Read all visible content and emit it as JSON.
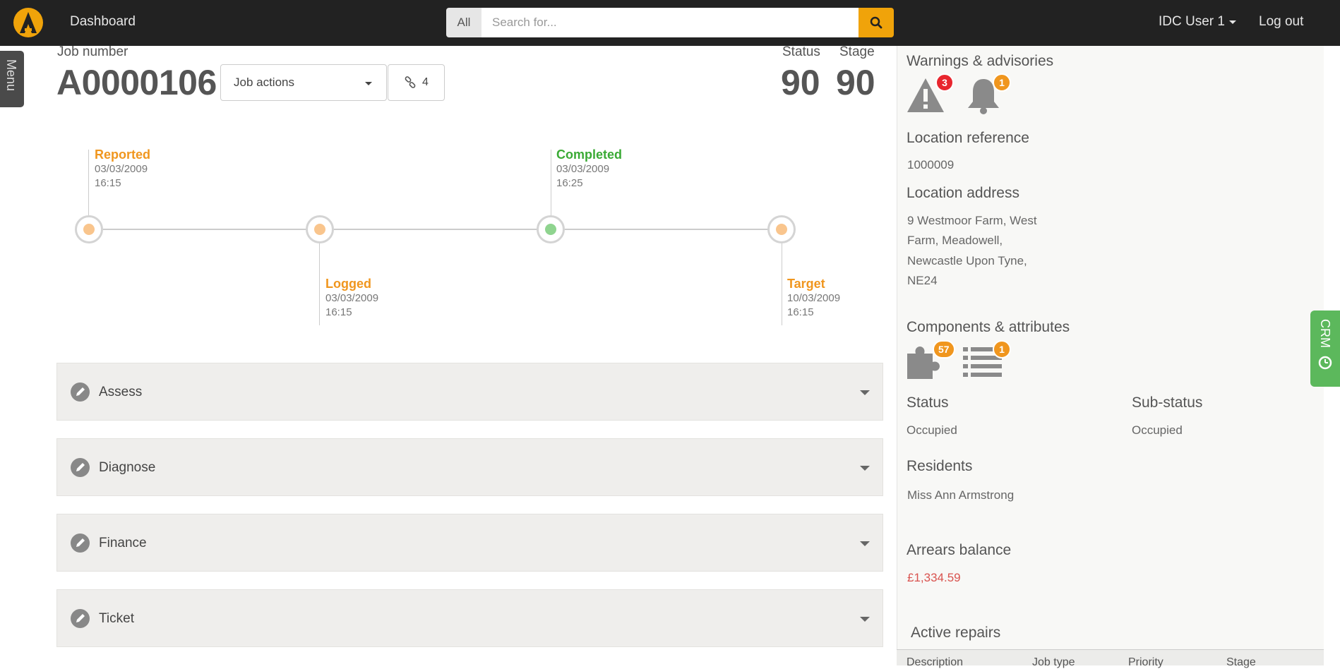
{
  "navbar": {
    "dashboard_label": "Dashboard",
    "search_scope": "All",
    "search_placeholder": "Search for...",
    "user_label": "IDC User 1",
    "logout_label": "Log out"
  },
  "side_menu": {
    "label": "Menu"
  },
  "job": {
    "number_label": "Job number",
    "number": "A0000106",
    "actions_label": "Job actions",
    "links_count": "4",
    "status_label": "Status",
    "status_value": "90",
    "stage_label": "Stage",
    "stage_value": "90"
  },
  "timeline": [
    {
      "title": "Reported",
      "date": "03/03/2009",
      "time": "16:15",
      "state": "pending",
      "color": "#f0961e"
    },
    {
      "title": "Logged",
      "date": "03/03/2009",
      "time": "16:15",
      "state": "pending",
      "color": "#f0961e"
    },
    {
      "title": "Completed",
      "date": "03/03/2009",
      "time": "16:25",
      "state": "done",
      "color": "#3aaa35"
    },
    {
      "title": "Target",
      "date": "10/03/2009",
      "time": "16:15",
      "state": "pending",
      "color": "#f0961e"
    }
  ],
  "sections": [
    {
      "label": "Assess"
    },
    {
      "label": "Diagnose"
    },
    {
      "label": "Finance"
    },
    {
      "label": "Ticket"
    }
  ],
  "panel": {
    "warnings_heading": "Warnings & advisories",
    "warnings_count": "3",
    "advisories_count": "1",
    "location_ref_heading": "Location reference",
    "location_ref_value": "1000009",
    "location_addr_heading": "Location address",
    "location_addr_lines": [
      "9 Westmoor Farm, West",
      "Farm, Meadowell,",
      "Newcastle Upon Tyne,",
      "NE24"
    ],
    "components_heading": "Components & attributes",
    "components_count": "57",
    "attributes_count": "1",
    "status_heading": "Status",
    "status_value": "Occupied",
    "substatus_heading": "Sub-status",
    "substatus_value": "Occupied",
    "residents_heading": "Residents",
    "residents_value": "Miss Ann Armstrong",
    "arrears_heading": "Arrears balance",
    "arrears_value": "£1,334.59",
    "active_repairs_heading": "Active repairs",
    "table_headers": [
      "Description",
      "Job type",
      "Priority",
      "Stage"
    ]
  },
  "crm_tab": {
    "label": "CRM"
  },
  "colors": {
    "navbar_bg": "#222222",
    "accent": "#f0a30a",
    "pending": "#f0961e",
    "completed": "#3aaa35",
    "danger_badge": "#e8262e",
    "warning_badge": "#f0961e",
    "crm_tab": "#5cb85c",
    "arrears_text": "#d9534f"
  }
}
